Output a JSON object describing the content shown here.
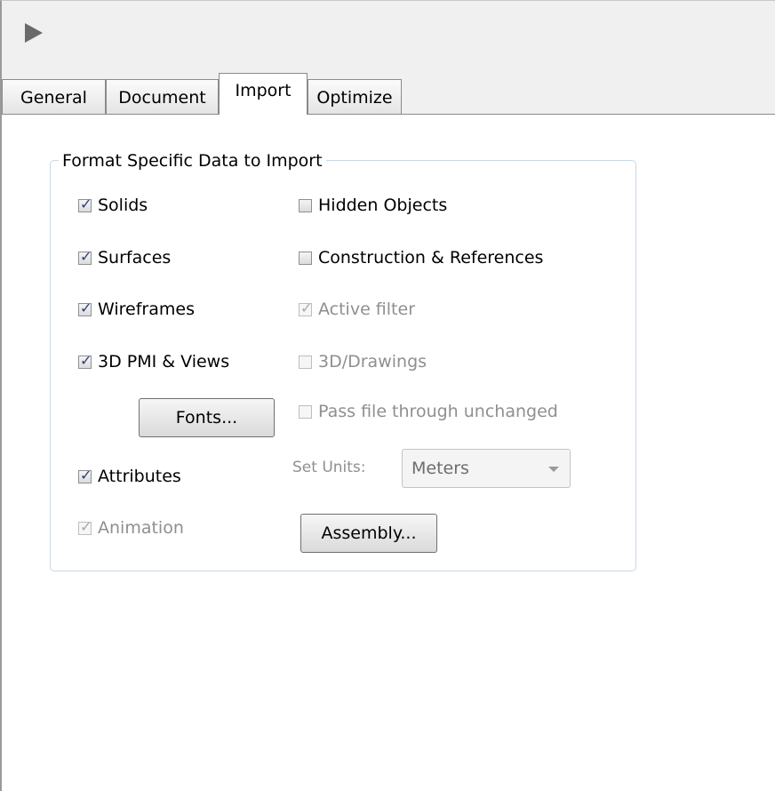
{
  "tabs": [
    {
      "label": "General",
      "active": false
    },
    {
      "label": "Document",
      "active": false
    },
    {
      "label": "Import",
      "active": true
    },
    {
      "label": "Optimize",
      "active": false
    }
  ],
  "group": {
    "title": "Format Specific Data to Import"
  },
  "checkboxes": {
    "solids": {
      "label": "Solids",
      "checked": true,
      "enabled": true
    },
    "surfaces": {
      "label": "Surfaces",
      "checked": true,
      "enabled": true
    },
    "wireframes": {
      "label": "Wireframes",
      "checked": true,
      "enabled": true
    },
    "pmi_views": {
      "label": "3D PMI & Views",
      "checked": true,
      "enabled": true
    },
    "attributes": {
      "label": "Attributes",
      "checked": true,
      "enabled": true
    },
    "animation": {
      "label": "Animation",
      "checked": true,
      "enabled": false
    },
    "hidden_objects": {
      "label": "Hidden Objects",
      "checked": false,
      "enabled": true
    },
    "construction_refs": {
      "label": "Construction & References",
      "checked": false,
      "enabled": true
    },
    "active_filter": {
      "label": "Active filter",
      "checked": true,
      "enabled": false
    },
    "drawings_3d": {
      "label": "3D/Drawings",
      "checked": false,
      "enabled": false
    },
    "pass_through": {
      "label": "Pass file through unchanged",
      "checked": false,
      "enabled": false
    }
  },
  "buttons": {
    "fonts": "Fonts...",
    "assembly": "Assembly..."
  },
  "units": {
    "label": "Set Units:",
    "value": "Meters"
  }
}
